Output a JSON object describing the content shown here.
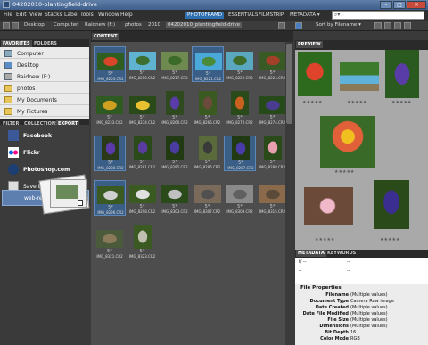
{
  "window": {
    "title": "04202010-plantingfield-drive"
  },
  "menu": [
    "File",
    "Edit",
    "View",
    "Stacks",
    "Label",
    "Tools",
    "Window",
    "Help"
  ],
  "workspaces": [
    "PHOTOFRAMD",
    "ESSENTIALS",
    "FILMSTRIP",
    "METADATA ▾"
  ],
  "search": {
    "value": "⌕▾"
  },
  "path": [
    "Desktop",
    "Computer",
    "Raidnew (F:)",
    "photos",
    "2010",
    "04202010_plantingfield-drive"
  ],
  "sort": "Sort by Filename ▾",
  "left_tabs": [
    "FAVORITES",
    "FOLDERS"
  ],
  "favorites": [
    "Computer",
    "Desktop",
    "Raidnew (F:)",
    "photos",
    "My Documents",
    "My Pictures"
  ],
  "bottom_tabs": [
    "FILTER",
    "COLLECTIONS",
    "EXPORT"
  ],
  "export": [
    "Facebook",
    "Flickr",
    "Photoshop.com",
    "Save to Hard..."
  ],
  "content_tab": "CONTENT",
  "preview_tab": "PREVIEW",
  "thumbnails": [
    {
      "name": "IMG_8203.CR2",
      "rating": "5*"
    },
    {
      "name": "IMG_8210.CR2",
      "rating": "5*"
    },
    {
      "name": "IMG_8217.CR2",
      "rating": "5*"
    },
    {
      "name": "IMG_8221.CR2",
      "rating": "5*"
    },
    {
      "name": "IMG_8222.CR2",
      "rating": "5*"
    },
    {
      "name": "IMG_8224.CR2",
      "rating": "5*"
    },
    {
      "name": "IMG_8233.CR2",
      "rating": "5*"
    },
    {
      "name": "IMG_8234.CR2",
      "rating": "5*"
    },
    {
      "name": "IMG_8260.CR2",
      "rating": "5*"
    },
    {
      "name": "IMG_8265.CR2",
      "rating": "5*"
    },
    {
      "name": "IMG_8270.CR2",
      "rating": "5*"
    },
    {
      "name": "IMG_8274.CR2",
      "rating": "5*"
    },
    {
      "name": "IMG_8280.CR2",
      "rating": "5*"
    },
    {
      "name": "IMG_8281.CR2",
      "rating": "5*"
    },
    {
      "name": "IMG_8285.CR2",
      "rating": "5*"
    },
    {
      "name": "IMG_8286.CR2",
      "rating": "5*"
    },
    {
      "name": "IMG_8287.CR2",
      "rating": "5*"
    },
    {
      "name": "IMG_8288.CR2",
      "rating": "5*"
    },
    {
      "name": "IMG_8296.CR2",
      "rating": "5*"
    },
    {
      "name": "IMG_8298.CR2",
      "rating": "5*"
    },
    {
      "name": "IMG_8303.CR2",
      "rating": "5*"
    },
    {
      "name": "IMG_8307.CR2",
      "rating": "5*"
    },
    {
      "name": "IMG_8309.CR2",
      "rating": "5*"
    },
    {
      "name": "IMG_8315.CR2",
      "rating": "5*"
    },
    {
      "name": "IMG_8321.CR2",
      "rating": "5*"
    },
    {
      "name": "IMG_8323.CR2",
      "rating": "5*"
    }
  ],
  "meta_tabs": [
    "METADATA",
    "KEYWORDS"
  ],
  "meta_summary": [
    "f/ --",
    "--",
    "--",
    "--"
  ],
  "file_properties_title": "File Properties",
  "file_properties": [
    {
      "k": "Filename",
      "v": "(Multiple values)"
    },
    {
      "k": "Document Type",
      "v": "Camera Raw image"
    },
    {
      "k": "Date Created",
      "v": "(Multiple values)"
    },
    {
      "k": "Date File Modified",
      "v": "(Multiple values)"
    },
    {
      "k": "File Size",
      "v": "(Multiple values)"
    },
    {
      "k": "Dimensions",
      "v": "(Multiple values)"
    },
    {
      "k": "Bit Depth",
      "v": "16"
    },
    {
      "k": "Color Mode",
      "v": "RGB"
    }
  ],
  "drag_label": "web-res"
}
